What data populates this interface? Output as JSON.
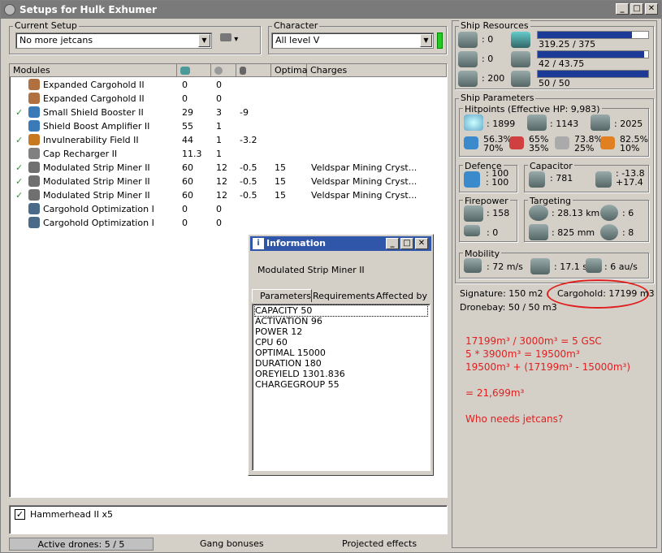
{
  "window": {
    "title": "Setups for Hulk Exhumer"
  },
  "current_setup": {
    "label": "Current Setup",
    "value": "No more jetcans"
  },
  "character": {
    "label": "Character",
    "value": "All level V"
  },
  "modules": {
    "headers": {
      "name": "Modules",
      "optimal": "Optimal",
      "charges": "Charges"
    },
    "rows": [
      {
        "name": "Expanded Cargohold II",
        "cpu": "0",
        "pg": "0",
        "cap": "",
        "optimal": "",
        "charges": "",
        "check": false,
        "icon": "cargohold-icon",
        "color": "#b07040"
      },
      {
        "name": "Expanded Cargohold II",
        "cpu": "0",
        "pg": "0",
        "cap": "",
        "optimal": "",
        "charges": "",
        "check": false,
        "icon": "cargohold-icon",
        "color": "#b07040"
      },
      {
        "name": "Small Shield Booster II",
        "cpu": "29",
        "pg": "3",
        "cap": "-9",
        "optimal": "",
        "charges": "",
        "check": true,
        "icon": "shield-booster-icon",
        "color": "#3a7ab8"
      },
      {
        "name": "Shield Boost Amplifier II",
        "cpu": "55",
        "pg": "1",
        "cap": "",
        "optimal": "",
        "charges": "",
        "check": false,
        "icon": "shield-amplifier-icon",
        "color": "#3a7ab8"
      },
      {
        "name": "Invulnerability Field II",
        "cpu": "44",
        "pg": "1",
        "cap": "-3.2",
        "optimal": "",
        "charges": "",
        "check": true,
        "icon": "invulnerability-icon",
        "color": "#c87820"
      },
      {
        "name": "Cap Recharger II",
        "cpu": "11.3",
        "pg": "1",
        "cap": "",
        "optimal": "",
        "charges": "",
        "check": false,
        "icon": "cap-recharger-icon",
        "color": "#808080"
      },
      {
        "name": "Modulated Strip Miner II",
        "cpu": "60",
        "pg": "12",
        "cap": "-0.5",
        "optimal": "15",
        "charges": "Veldspar Mining Cryst...",
        "check": true,
        "icon": "strip-miner-icon",
        "color": "#707070"
      },
      {
        "name": "Modulated Strip Miner II",
        "cpu": "60",
        "pg": "12",
        "cap": "-0.5",
        "optimal": "15",
        "charges": "Veldspar Mining Cryst...",
        "check": true,
        "icon": "strip-miner-icon",
        "color": "#707070"
      },
      {
        "name": "Modulated Strip Miner II",
        "cpu": "60",
        "pg": "12",
        "cap": "-0.5",
        "optimal": "15",
        "charges": "Veldspar Mining Cryst...",
        "check": true,
        "icon": "strip-miner-icon",
        "color": "#707070"
      },
      {
        "name": "Cargohold Optimization I",
        "cpu": "0",
        "pg": "0",
        "cap": "",
        "optimal": "",
        "charges": "",
        "check": false,
        "icon": "rig-icon",
        "color": "#4a6a8a"
      },
      {
        "name": "Cargohold Optimization I",
        "cpu": "0",
        "pg": "0",
        "cap": "",
        "optimal": "",
        "charges": "",
        "check": false,
        "icon": "rig-icon",
        "color": "#4a6a8a"
      }
    ]
  },
  "info_dialog": {
    "title": "Information",
    "item": "Modulated Strip Miner II",
    "tabs": [
      "Parameters",
      "Requirements",
      "Affected by"
    ],
    "params": [
      "CAPACITY 50",
      "ACTIVATION 96",
      "POWER 12",
      "CPU 60",
      "OPTIMAL 15000",
      "DURATION 180",
      "OREYIELD 1301.836",
      "CHARGEGROUP 55"
    ]
  },
  "drones": {
    "item": "Hammerhead II x5",
    "checked": true
  },
  "status": {
    "active_drones": "Active drones: 5 / 5",
    "gang": "Gang bonuses",
    "projected": "Projected effects"
  },
  "resources": {
    "label": "Ship Resources",
    "turrets": ": 0",
    "launchers": ": 0",
    "calibration": ": 200",
    "cpu": {
      "text": "319.25 / 375",
      "fraction": 0.851
    },
    "powergrid": {
      "text": "42 / 43.75",
      "fraction": 0.96
    },
    "drone_bw": {
      "text": "50 / 50",
      "fraction": 1.0
    }
  },
  "parameters": {
    "label": "Ship Parameters",
    "hitpoints": {
      "label": "Hitpoints (Effective HP: 9,983)",
      "shield": ": 1899",
      "armor": ": 1143",
      "structure": ": 2025",
      "em": [
        "56.3%",
        "70%"
      ],
      "thermal": [
        "65%",
        "35%"
      ],
      "kinetic": [
        "73.8%",
        "25%"
      ],
      "explosive": [
        "82.5%",
        "10%"
      ]
    },
    "defence": {
      "label": "Defence",
      "v1": ": 100",
      "v2": ": 100"
    },
    "capacitor": {
      "label": "Capacitor",
      "capacity": ": 781",
      "delta1": ": -13.8",
      "delta2": "+17.4"
    },
    "firepower": {
      "label": "Firepower",
      "dps": ": 158",
      "volley": ": 0"
    },
    "targeting": {
      "label": "Targeting",
      "range": ": 28.13 km",
      "max_targets": ": 6",
      "scan": ": 825 mm",
      "sensor": ": 8"
    },
    "mobility": {
      "label": "Mobility",
      "speed": ": 72 m/s",
      "align": ": 17.1 s",
      "warp": ": 6 au/s"
    },
    "signature": "Signature: 150 m2",
    "dronebay": "Dronebay: 50 / 50 m3",
    "cargohold": "Cargohold: 17199 m3"
  },
  "notes": {
    "line1": "17199m³ / 3000m³ = 5 GSC",
    "line2": "5 * 3900m³ = 19500m³",
    "line3": "19500m³ + (17199m³ - 15000m³)",
    "line4": "= 21,699m³",
    "line5": "Who needs jetcans?"
  },
  "colors": {
    "bar": "#1c3b96",
    "titlebar": "#7a7a7a",
    "annotation": "#e02020"
  }
}
